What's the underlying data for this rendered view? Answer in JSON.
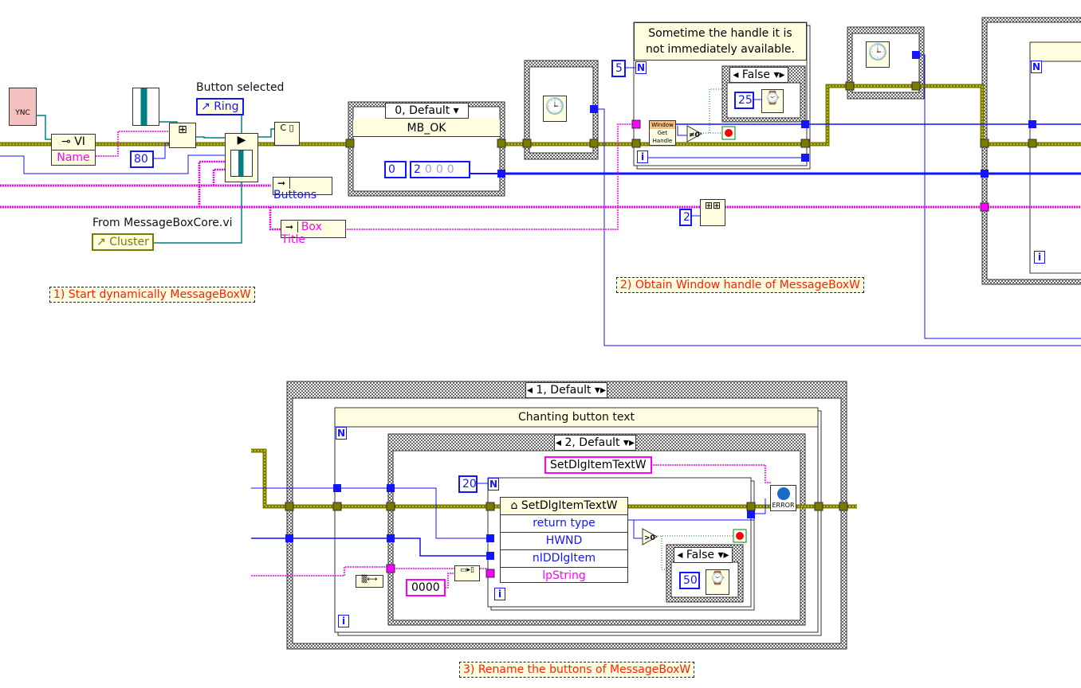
{
  "diagram": {
    "labels": {
      "button_selected": "Button selected",
      "from_core": "From MessageBoxCore.vi"
    },
    "comments": [
      "1) Start dynamically MessageBoxW",
      "2) Obtain Window handle of  MessageBoxW",
      "3) Rename the buttons of MessageBoxW"
    ],
    "notes": {
      "handle_note": "Sometime the handle it is not immediately available.",
      "mb_ok": "MB_OK",
      "chanting": "Chanting button text"
    },
    "nodes": {
      "open_vi_ref": "VI",
      "name_prop": "Name",
      "ring_ref": "Ring",
      "cluster_ref": "Cluster",
      "buttons_prop": "Buttons",
      "box_title_prop": "Box Title",
      "window_get_handle": [
        "Window",
        "Get",
        "Handle"
      ],
      "error_icon": "ERROR"
    },
    "constants": {
      "options": "80",
      "array_index": "0",
      "array_vals": [
        "2",
        "0",
        "0",
        "0"
      ],
      "loop_count_top": "5",
      "wait_top": "25",
      "array_size": "2",
      "loop_count_bottom": "20",
      "wait_bottom": "50",
      "string_zero": "0000",
      "fn_name": "SetDlgItemTextW"
    },
    "selectors": {
      "case_top": "0, Default",
      "case_false_top": "False",
      "case_outer_bottom": "1, Default",
      "case_inner_bottom": "2, Default",
      "case_false_bottom": "False"
    },
    "call_library": {
      "title": "SetDlgItemTextW",
      "params": [
        "return type",
        "HWND",
        "nIDDlgItem",
        "lpString"
      ]
    },
    "terminals": {
      "count": "N",
      "iteration": "i"
    },
    "colors": {
      "error_wire": "#7a7a00",
      "numeric_wire": "#1414ff",
      "string_wire": "#ff00ff",
      "ref_wire": "#008080",
      "boolean_wire": "#008000",
      "comment_text": "#ff2000",
      "node_fill": "#fffde0"
    }
  }
}
